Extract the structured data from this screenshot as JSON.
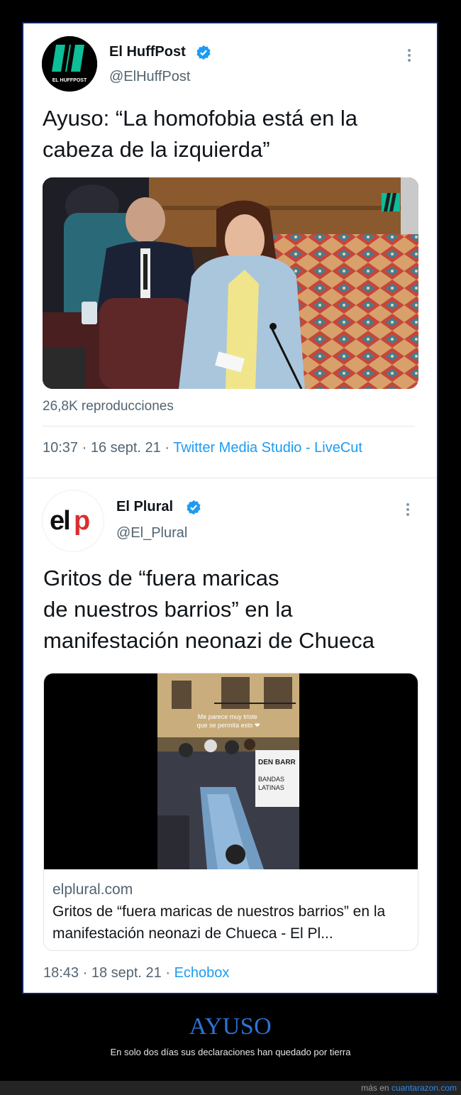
{
  "tweet1": {
    "display_name": "El HuffPost",
    "handle": "@ElHuffPost",
    "avatar_text": "EL HUFFPOST",
    "text": "Ayuso: “La homofobia está en la\ncabeza de la izquierda”",
    "views": "26,8K reproducciones",
    "time": "10:37 · 16 sept. 21 · ",
    "source": "Twitter Media Studio - LiveCut"
  },
  "tweet2": {
    "display_name": "El Plural",
    "handle": "@El_Plural",
    "avatar_text": "elp",
    "text": "Gritos de “fuera maricas\nde nuestros barrios” en la\nmanifestación neonazi de Chueca",
    "video_overlay": "Me parece muy triste\nque se permita esto ❤",
    "card_domain": "elplural.com",
    "card_title": "Gritos de “fuera maricas de nuestros barrios” en la manifestación neonazi de Chueca - El Pl...",
    "time": "18:43 · 18 sept. 21 · ",
    "source": "Echobox"
  },
  "caption": {
    "title": "AYUSO",
    "subtitle": "En solo dos días sus declaraciones han quedado por tierra"
  },
  "footer": {
    "prefix": "más en ",
    "site": "cuantarazon.com"
  },
  "colors": {
    "verified": "#1d9bf0",
    "link": "#1d9bf0",
    "caption_title": "#2b74d8",
    "huffpost_green": "#0dbe98"
  }
}
